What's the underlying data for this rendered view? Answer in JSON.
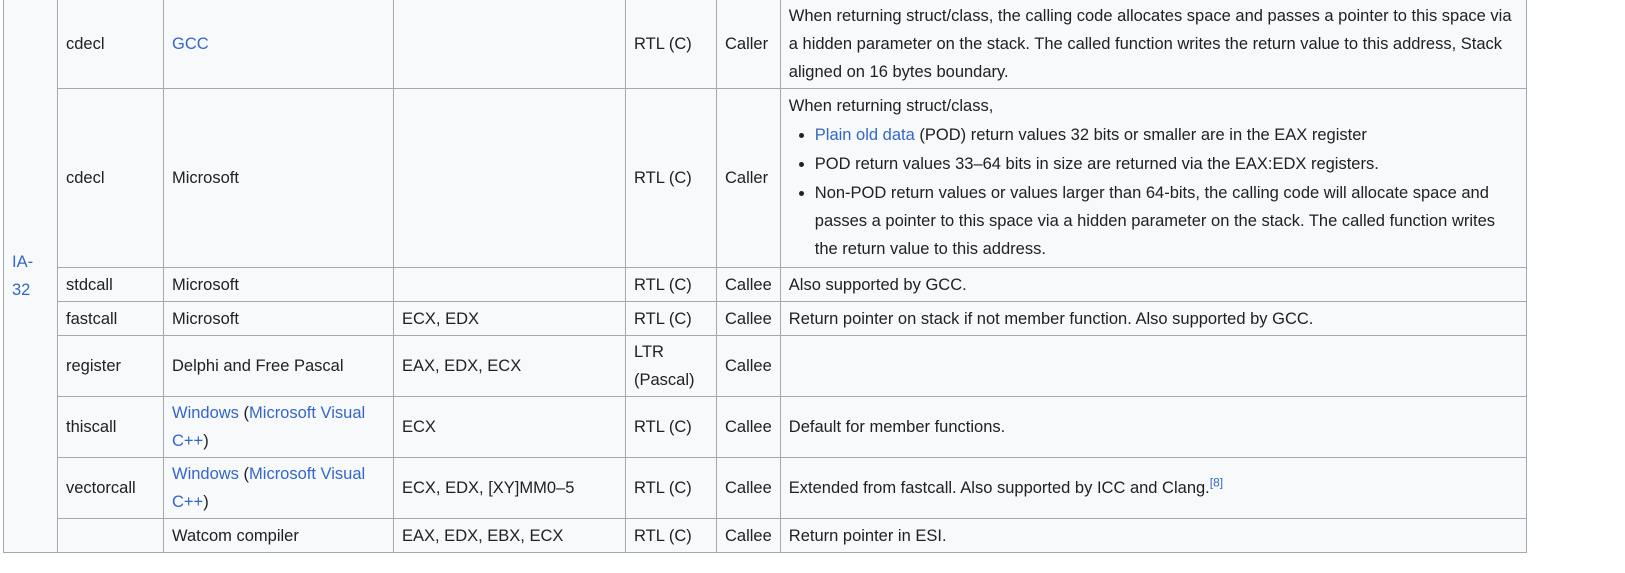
{
  "arch_label": "IA-32",
  "rows": [
    {
      "name": "cdecl",
      "impl": "GCC",
      "regs": "",
      "order": "RTL (C)",
      "cleanup": "Caller",
      "notes": "When returning struct/class, the calling code allocates space and passes a pointer to this space via a hidden parameter on the stack. The called function writes the return value to this address, Stack aligned on 16 bytes boundary."
    },
    {
      "name": "cdecl",
      "impl": "Microsoft",
      "regs": "",
      "order": "RTL (C)",
      "cleanup": "Caller",
      "notes_intro": "When returning struct/class,",
      "bullet1_link": "Plain old data",
      "bullet1_rest": " (POD) return values 32 bits or smaller are in the EAX register",
      "bullet2": "POD return values 33–64 bits in size are returned via the EAX:EDX registers.",
      "bullet3": "Non-POD return values or values larger than 64-bits, the calling code will allocate space and passes a pointer to this space via a hidden parameter on the stack. The called function writes the return value to this address."
    },
    {
      "name": "stdcall",
      "impl": "Microsoft",
      "regs": "",
      "order": "RTL (C)",
      "cleanup": "Callee",
      "notes": "Also supported by GCC."
    },
    {
      "name": "fastcall",
      "impl": "Microsoft",
      "regs": "ECX, EDX",
      "order": "RTL (C)",
      "cleanup": "Callee",
      "notes": "Return pointer on stack if not member function. Also supported by GCC."
    },
    {
      "name": "register",
      "impl": "Delphi and Free Pascal",
      "regs": "EAX, EDX, ECX",
      "order": "LTR (Pascal)",
      "cleanup": "Callee",
      "notes": ""
    },
    {
      "name": "thiscall",
      "impl_link1": "Windows",
      "impl_open": " (",
      "impl_link2": "Microsoft Visual C++",
      "impl_close": ")",
      "regs": "ECX",
      "order": "RTL (C)",
      "cleanup": "Callee",
      "notes": "Default for member functions."
    },
    {
      "name": "vectorcall",
      "impl_link1": "Windows",
      "impl_open": " (",
      "impl_link2": "Microsoft Visual C++",
      "impl_close": ")",
      "regs": "ECX, EDX, [XY]MM0–5",
      "order": "RTL (C)",
      "cleanup": "Callee",
      "notes": "Extended from fastcall. Also supported by ICC and Clang.",
      "notes_ref": "[8]"
    },
    {
      "name": "",
      "impl": "Watcom compiler",
      "regs": "EAX, EDX, EBX, ECX",
      "order": "RTL (C)",
      "cleanup": "Callee",
      "notes": "Return pointer in ESI."
    }
  ]
}
